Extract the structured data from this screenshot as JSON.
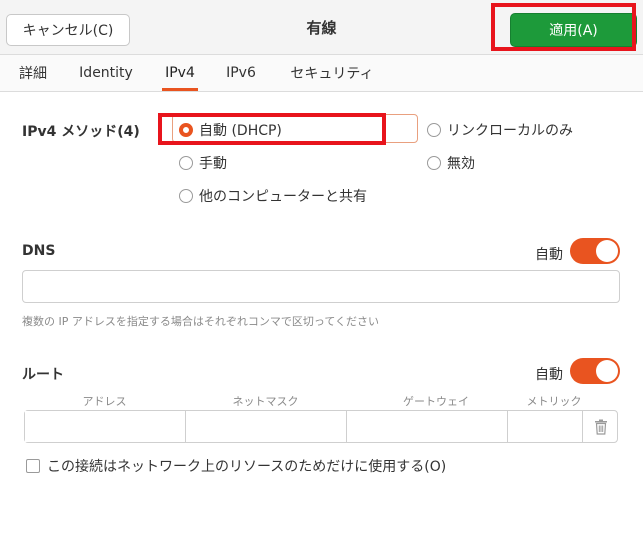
{
  "header": {
    "title": "有線",
    "cancel_label": "キャンセル(C)",
    "apply_label": "適用(A)"
  },
  "tabs": [
    {
      "label": "詳細"
    },
    {
      "label": "Identity"
    },
    {
      "label": "IPv4"
    },
    {
      "label": "IPv6"
    },
    {
      "label": "セキュリティ"
    }
  ],
  "active_tab": "IPv4",
  "ipv4": {
    "method_label": "IPv4 メソッド(4)",
    "methods": [
      {
        "label": "自動 (DHCP)",
        "checked": true
      },
      {
        "label": "リンクローカルのみ",
        "checked": false
      },
      {
        "label": "手動",
        "checked": false
      },
      {
        "label": "無効",
        "checked": false
      },
      {
        "label": "他のコンピューターと共有",
        "checked": false
      }
    ]
  },
  "dns": {
    "label": "DNS",
    "auto_label": "自動",
    "auto_enabled": true,
    "value": "",
    "hint": "複数の IP アドレスを指定する場合はそれぞれコンマで区切ってください"
  },
  "routes": {
    "label": "ルート",
    "auto_label": "自動",
    "auto_enabled": true,
    "columns": [
      "アドレス",
      "ネットマスク",
      "ゲートウェイ",
      "メトリック"
    ]
  },
  "only_local_resources": {
    "label": "この接続はネットワーク上のリソースのためだけに使用する(O)",
    "checked": false
  },
  "colors": {
    "accent": "#e95420",
    "apply_green": "#1d9a3a",
    "highlight_red": "#e8141c"
  }
}
